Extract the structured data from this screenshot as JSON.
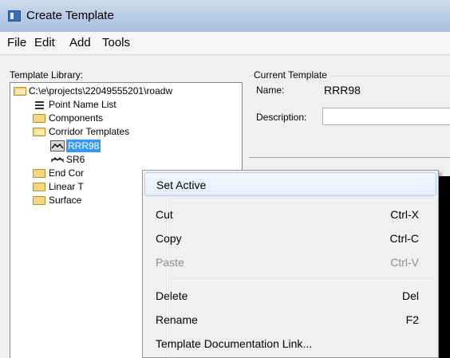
{
  "window": {
    "title": "Create Template"
  },
  "menubar": {
    "items": [
      "File",
      "Edit",
      "Add",
      "Tools"
    ]
  },
  "library": {
    "label": "Template Library:",
    "root": "C:\\e\\projects\\22049555201\\roadw",
    "nodes": {
      "point_name_list": "Point Name List",
      "components": "Components",
      "corridor_templates": "Corridor Templates",
      "selected_template": "RRR98",
      "sr_template": "SR6",
      "end_conditions": "End Cor",
      "linear": "Linear T",
      "surface": "Surface"
    }
  },
  "current_template": {
    "legend": "Current Template",
    "name_label": "Name:",
    "name_value": "RRR98",
    "description_label": "Description:",
    "description_value": ""
  },
  "context_menu": {
    "set_active": "Set Active",
    "cut": {
      "label": "Cut",
      "shortcut": "Ctrl-X"
    },
    "copy": {
      "label": "Copy",
      "shortcut": "Ctrl-C"
    },
    "paste": {
      "label": "Paste",
      "shortcut": "Ctrl-V"
    },
    "delete": {
      "label": "Delete",
      "shortcut": "Del"
    },
    "rename": {
      "label": "Rename",
      "shortcut": "F2"
    },
    "doc_link": "Template Documentation Link..."
  }
}
